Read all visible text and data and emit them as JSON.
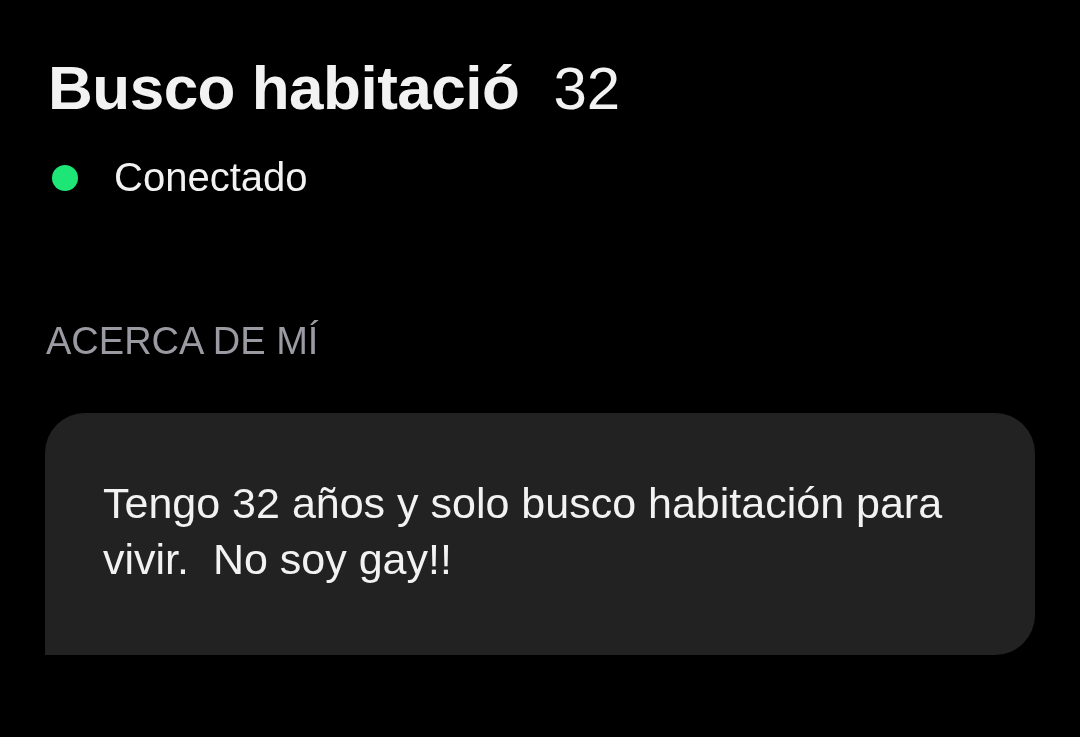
{
  "profile": {
    "name": "Busco habitació",
    "age": "32",
    "online": true,
    "status": "Conectado"
  },
  "about": {
    "heading": "ACERCA DE MÍ",
    "text": "Tengo 32 años y solo busco habitación para vivir.  No soy gay!!"
  }
}
